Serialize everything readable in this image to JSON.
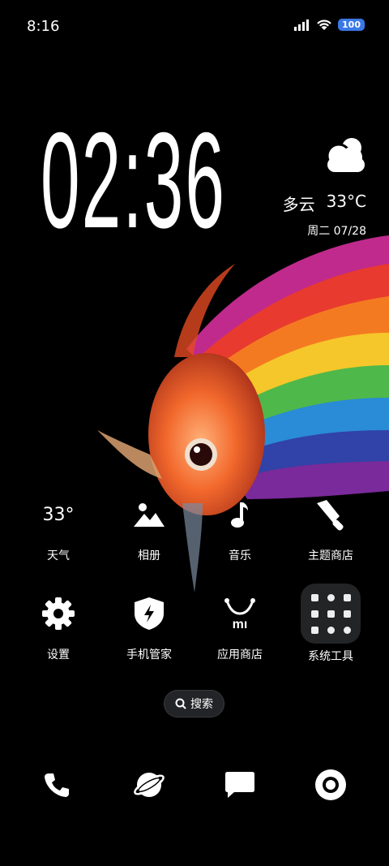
{
  "status_bar": {
    "time": "8:16",
    "battery": "100"
  },
  "clock": {
    "time": "02:36"
  },
  "weather": {
    "condition": "多云",
    "temperature": "33°C",
    "date": "周二 07/28"
  },
  "apps": [
    {
      "label": "天气",
      "icon": "weather-temp-icon",
      "icon_text": "33°"
    },
    {
      "label": "相册",
      "icon": "gallery-icon"
    },
    {
      "label": "音乐",
      "icon": "music-note-icon"
    },
    {
      "label": "主题商店",
      "icon": "paintbrush-icon"
    },
    {
      "label": "设置",
      "icon": "gear-icon"
    },
    {
      "label": "手机管家",
      "icon": "shield-bolt-icon"
    },
    {
      "label": "应用商店",
      "icon": "mi-store-icon"
    },
    {
      "label": "系统工具",
      "icon": "folder-icon"
    }
  ],
  "search": {
    "label": "搜索"
  },
  "dock": [
    {
      "icon": "phone-icon"
    },
    {
      "icon": "browser-planet-icon"
    },
    {
      "icon": "messages-icon"
    },
    {
      "icon": "camera-icon"
    }
  ]
}
